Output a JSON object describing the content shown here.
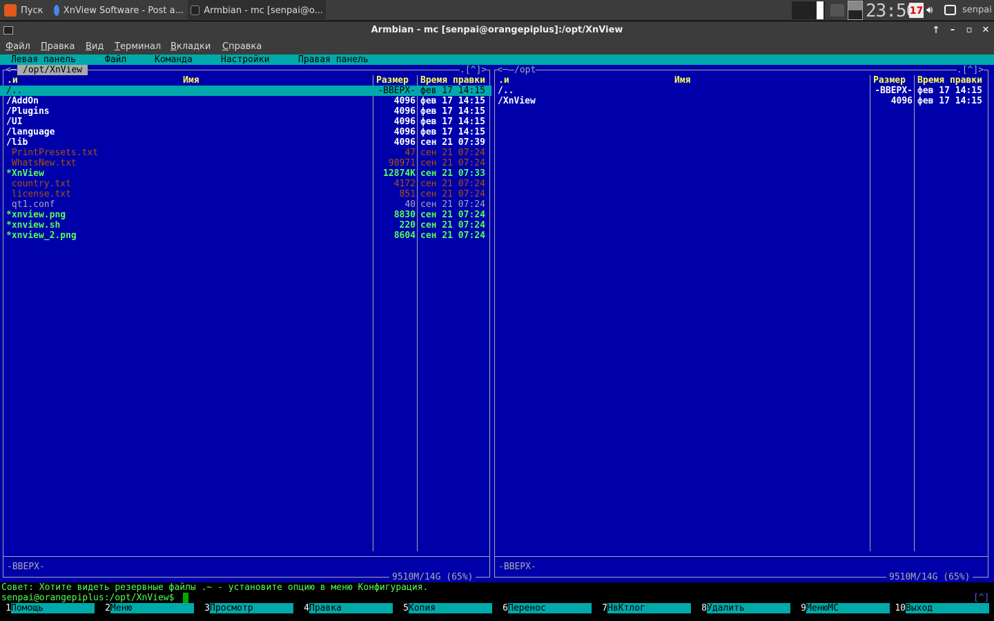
{
  "taskbar": {
    "start_label": "Пуск",
    "tasks": [
      "XnView Software - Post a...",
      "Armbian - mc [senpai@o..."
    ],
    "clock": "23:56",
    "calendar_day": "17",
    "user": "senpai"
  },
  "window": {
    "title": "Armbian - mc [senpai@orangepiplus]:/opt/XnView"
  },
  "menubar": [
    "Файл",
    "Правка",
    "Вид",
    "Терминал",
    "Вкладки",
    "Справка"
  ],
  "mc_menu": [
    "Левая панель",
    "Файл",
    "Команда",
    "Настройки",
    "Правая панель"
  ],
  "left_panel": {
    "path": "/opt/XnView",
    "corner": ".[^]>",
    "sort": ".и",
    "headers": {
      "name": "Имя",
      "size": "Размер",
      "time": "Время правки"
    },
    "rows": [
      {
        "name": "/..",
        "size": "-ВВЕРХ-",
        "time": "фев 17 14:15",
        "type": "sel"
      },
      {
        "name": "/AddOn",
        "size": "4096",
        "time": "фев 17 14:15",
        "type": "dir"
      },
      {
        "name": "/Plugins",
        "size": "4096",
        "time": "фев 17 14:15",
        "type": "dir"
      },
      {
        "name": "/UI",
        "size": "4096",
        "time": "фев 17 14:15",
        "type": "dir"
      },
      {
        "name": "/language",
        "size": "4096",
        "time": "фев 17 14:15",
        "type": "dir"
      },
      {
        "name": "/lib",
        "size": "4096",
        "time": "сен 21 07:39",
        "type": "dir"
      },
      {
        "name": " PrintPresets.txt",
        "size": "47",
        "time": "сен 21 07:24",
        "type": "txt"
      },
      {
        "name": " WhatsNew.txt",
        "size": "98971",
        "time": "сен 21 07:24",
        "type": "txt"
      },
      {
        "name": "*XnView",
        "size": "12874K",
        "time": "сен 21 07:33",
        "type": "exe"
      },
      {
        "name": " country.txt",
        "size": "4172",
        "time": "сен 21 07:24",
        "type": "txt"
      },
      {
        "name": " license.txt",
        "size": "851",
        "time": "сен 21 07:24",
        "type": "txt"
      },
      {
        "name": " qt1.conf",
        "size": "40",
        "time": "сен 21 07:24",
        "type": "plain"
      },
      {
        "name": "*xnview.png",
        "size": "8830",
        "time": "сен 21 07:24",
        "type": "exe"
      },
      {
        "name": "*xnview.sh",
        "size": "220",
        "time": "сен 21 07:24",
        "type": "exe"
      },
      {
        "name": "*xnview_2.png",
        "size": "8604",
        "time": "сен 21 07:24",
        "type": "exe"
      }
    ],
    "mini_status": "-ВВЕРХ-",
    "disk": "9510M/14G (65%)"
  },
  "right_panel": {
    "path": "/opt",
    "corner": ".[^]>",
    "sort": ".и",
    "headers": {
      "name": "Имя",
      "size": "Размер",
      "time": "Время правки"
    },
    "rows": [
      {
        "name": "/..",
        "size": "-ВВЕРХ-",
        "time": "фев 17 14:15",
        "type": "dir"
      },
      {
        "name": "/XnView",
        "size": "4096",
        "time": "фев 17 14:15",
        "type": "dir"
      }
    ],
    "mini_status": "-ВВЕРХ-",
    "disk": "9510M/14G (65%)"
  },
  "hint": "Совет: Хотите видеть резервные файлы .~ - установите опцию в меню Конфигурация.",
  "prompt": "senpai@orangepiplus:/opt/XnView$",
  "scroll_indicator": "[^]",
  "fkeys": [
    {
      "n": "1",
      "l": "Помощь"
    },
    {
      "n": "2",
      "l": "Меню"
    },
    {
      "n": "3",
      "l": "Просмотр"
    },
    {
      "n": "4",
      "l": "Правка"
    },
    {
      "n": "5",
      "l": "Копия"
    },
    {
      "n": "6",
      "l": "Перенос"
    },
    {
      "n": "7",
      "l": "НвКтлог"
    },
    {
      "n": "8",
      "l": "Удалить"
    },
    {
      "n": "9",
      "l": "МенюМС"
    },
    {
      "n": "10",
      "l": "Выход"
    }
  ]
}
